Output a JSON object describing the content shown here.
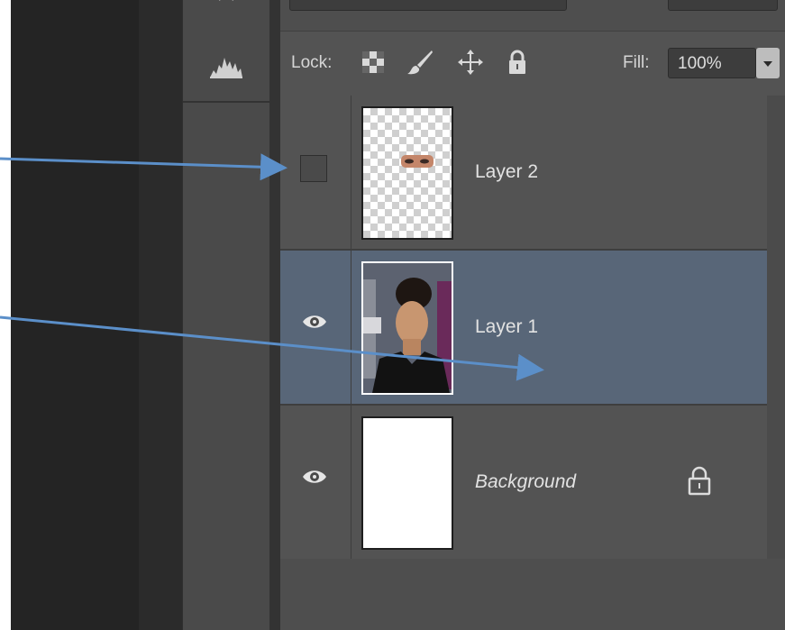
{
  "lock": {
    "label": "Lock:",
    "icons": [
      "lock-transparent-pixels-icon",
      "lock-image-pixels-icon",
      "lock-position-icon",
      "lock-all-icon"
    ]
  },
  "fill": {
    "label": "Fill:",
    "value": "100%"
  },
  "layers": [
    {
      "name": "Layer 2",
      "visible": false,
      "selected": false,
      "thumbnail": "transparent-with-eyes"
    },
    {
      "name": "Layer 1",
      "visible": true,
      "selected": true,
      "thumbnail": "portrait-photo"
    },
    {
      "name": "Background",
      "visible": true,
      "selected": false,
      "locked": true,
      "italic": true,
      "thumbnail": "white"
    }
  ],
  "tools": [
    "histogram-icon"
  ],
  "colors": {
    "selected_row": "#586678",
    "panel": "#535353",
    "arrow": "#5b8fc9"
  }
}
